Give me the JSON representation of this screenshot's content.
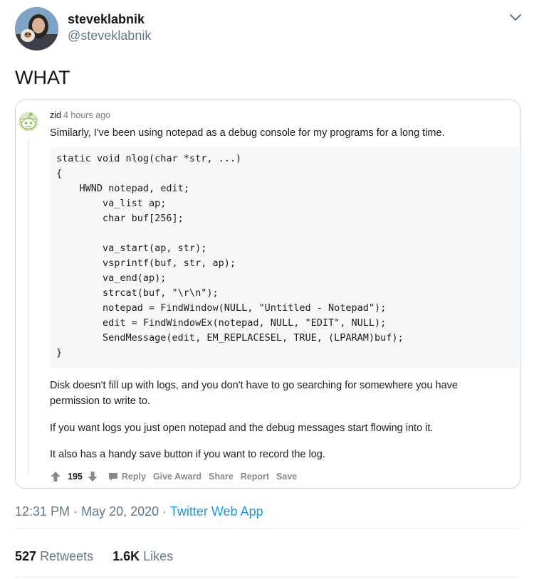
{
  "tweet": {
    "display_name": "steveklabnik",
    "handle": "@steveklabnik",
    "text": "WHAT",
    "time": "12:31 PM",
    "date": "May 20, 2020",
    "separator": "·",
    "source": "Twitter Web App",
    "retweets_count": "527",
    "retweets_label": "Retweets",
    "likes_count": "1.6K",
    "likes_label": "Likes"
  },
  "embed": {
    "username": "zid",
    "time_ago": "4 hours ago",
    "intro": "Similarly, I've been using notepad as a debug console for my programs for a long time.",
    "code": "static void nlog(char *str, ...)\n{\n    HWND notepad, edit;\n        va_list ap;\n        char buf[256];\n\n        va_start(ap, str);\n        vsprintf(buf, str, ap);\n        va_end(ap);\n        strcat(buf, \"\\r\\n\");\n        notepad = FindWindow(NULL, \"Untitled - Notepad\");\n        edit = FindWindowEx(notepad, NULL, \"EDIT\", NULL);\n        SendMessage(edit, EM_REPLACESEL, TRUE, (LPARAM)buf);\n}",
    "paragraphs": [
      "Disk doesn't fill up with logs, and you don't have to go searching for somewhere you have permission to write to.",
      "If you want logs you just open notepad and the debug messages start flowing into it.",
      "It also has a handy save button if you want to record the log."
    ],
    "score": "195",
    "actions": {
      "reply": "Reply",
      "give_award": "Give Award",
      "share": "Share",
      "report": "Report",
      "save": "Save"
    }
  },
  "colors": {
    "text": "#14171a",
    "muted": "#657786",
    "link": "#1b95e0",
    "border": "#ccd6dd",
    "reddit_gray": "#878a8c",
    "code_bg": "#f6f7f8"
  },
  "icons": [
    "chevron-down-icon",
    "snoo-icon",
    "upvote-icon",
    "downvote-icon",
    "comment-icon"
  ]
}
